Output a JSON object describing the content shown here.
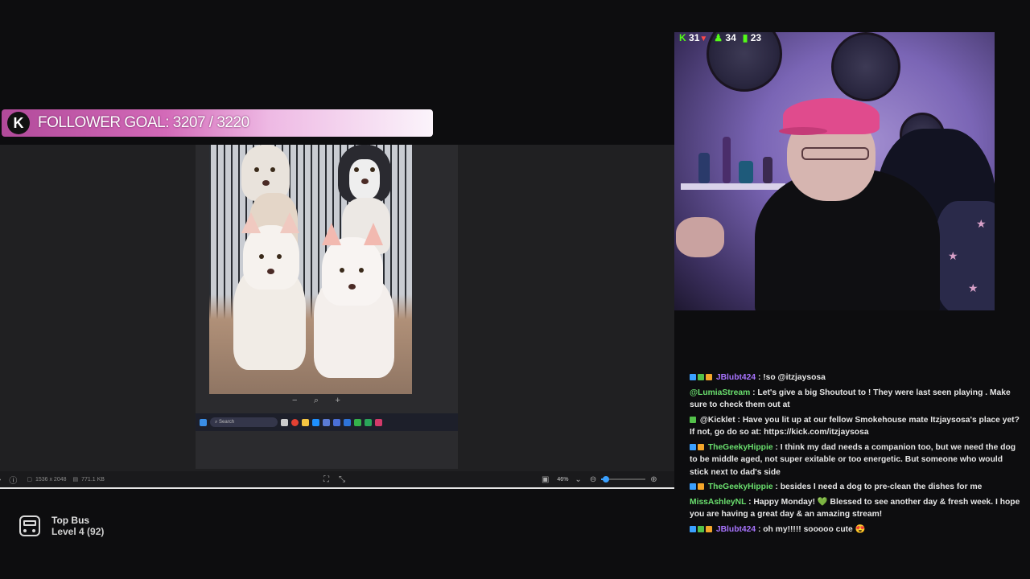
{
  "goal": {
    "badge": "K",
    "text": "FOLLOWER GOAL: 3207 / 3220"
  },
  "viewer": {
    "zoom_out": "−",
    "zoom_icon": "⌕",
    "zoom_in": "+",
    "taskbar_search": "Search",
    "status": {
      "dimensions": "1536 x 2048",
      "filesize": "771.1 KB",
      "zoom_percent": "46%",
      "zoom_fraction": 0.1
    }
  },
  "webcam": {
    "kick_count": "31",
    "viewer_count": "34",
    "bar_count": "23",
    "colors": {
      "accent": "#53fc18"
    }
  },
  "chat": {
    "messages": [
      {
        "user": "JBlubt424",
        "user_color": "#a874ff",
        "badges": [
          "#3aa0ff",
          "#53c14a",
          "#f4a62a"
        ],
        "text": " : !so @itzjaysosa"
      },
      {
        "user": "@LumiaStream",
        "user_color": "#6adf6e",
        "badges": [],
        "text": " : Let's give a big Shoutout to ! They were last seen playing . Make sure to check them out at"
      },
      {
        "user": "@Kicklet",
        "user_color": "#e6e6e6",
        "badges": [
          "#53c14a"
        ],
        "text": " : Have you lit up at our fellow Smokehouse mate Itzjaysosa's place yet? If not, go do so at: https://kick.com/itzjaysosa"
      },
      {
        "user": "TheGeekyHippie",
        "user_color": "#6adf6e",
        "badges": [
          "#3aa0ff",
          "#f4a62a"
        ],
        "text": " : I think my dad needs a companion too, but we need the dog to be middle aged, not super exitable or too energetic. But someone who would stick next to dad's side"
      },
      {
        "user": "TheGeekyHippie",
        "user_color": "#6adf6e",
        "badges": [
          "#3aa0ff",
          "#f4a62a"
        ],
        "text": " : besides I need a dog to pre-clean the dishes for me"
      },
      {
        "user": "MissAshleyNL",
        "user_color": "#6adf6e",
        "badges": [],
        "text": " : Happy Monday! 💚 Blessed to see another day & fresh week. I hope you are having a great day & an amazing stream!"
      },
      {
        "user": "JBlubt424",
        "user_color": "#a874ff",
        "badges": [
          "#3aa0ff",
          "#53c14a",
          "#f4a62a"
        ],
        "text": " : oh my!!!!! sooooo cute 😍"
      }
    ]
  },
  "topbus": {
    "title": "Top Bus",
    "level": "Level 4  (92)"
  }
}
